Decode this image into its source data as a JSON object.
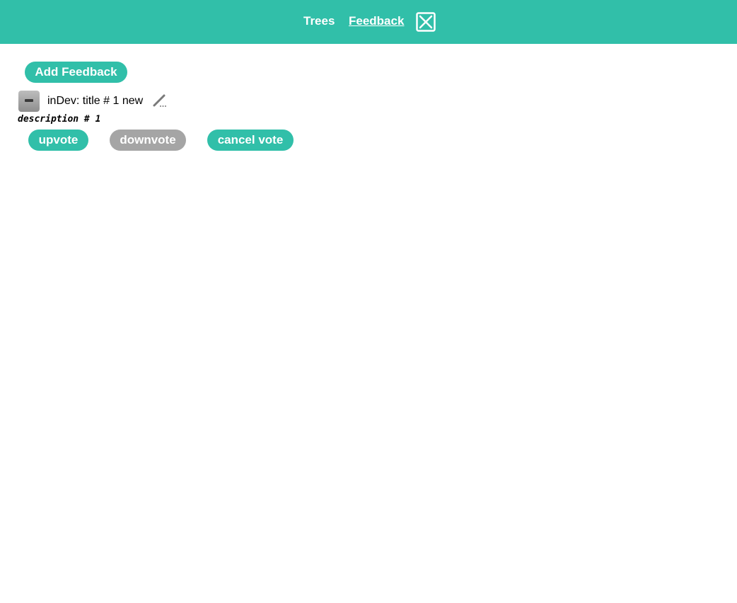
{
  "nav": {
    "trees_label": "Trees",
    "feedback_label": "Feedback",
    "close_icon": "close-box-icon"
  },
  "toolbar": {
    "add_feedback_label": "Add Feedback"
  },
  "feedback_items": [
    {
      "title": "inDev: title # 1 new",
      "description": "description # 1",
      "collapse_icon": "minus-icon",
      "edit_icon": "pencil-icon",
      "actions": {
        "upvote_label": "upvote",
        "downvote_label": "downvote",
        "cancel_vote_label": "cancel vote"
      }
    }
  ],
  "colors": {
    "accent": "#31bfa9",
    "disabled": "#a5a5a5",
    "background": "#ffffff"
  }
}
